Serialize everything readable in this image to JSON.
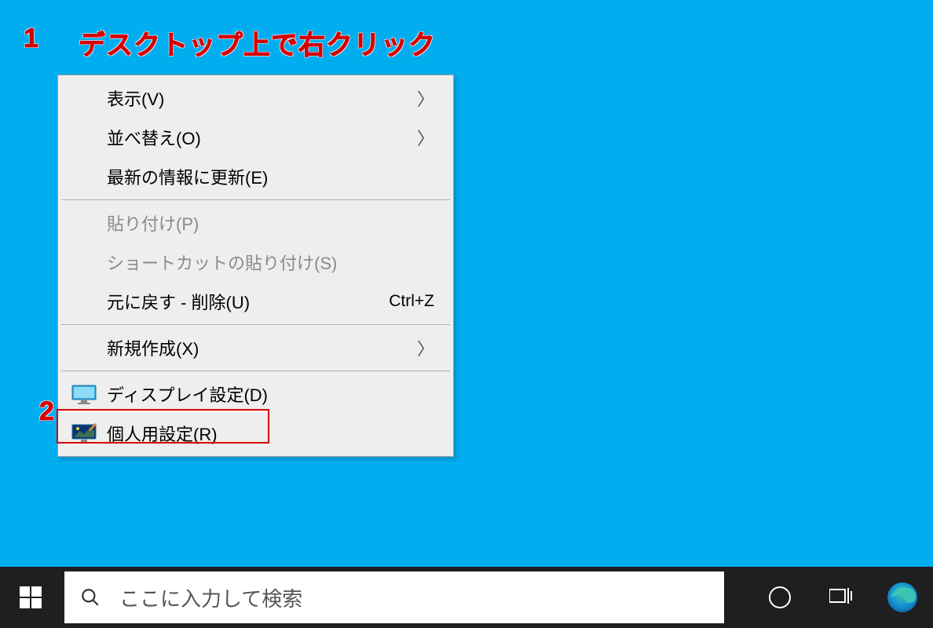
{
  "annotations": {
    "one": "1",
    "one_text": "デスクトップ上で右クリック",
    "two": "2"
  },
  "context_menu": {
    "items": [
      {
        "label": "表示(V)",
        "has_submenu": true
      },
      {
        "label": "並べ替え(O)",
        "has_submenu": true
      },
      {
        "label": "最新の情報に更新(E)"
      }
    ],
    "items2": [
      {
        "label": "貼り付け(P)",
        "disabled": true
      },
      {
        "label": "ショートカットの貼り付け(S)",
        "disabled": true
      },
      {
        "label": "元に戻す - 削除(U)",
        "shortcut": "Ctrl+Z"
      }
    ],
    "items3": [
      {
        "label": "新規作成(X)",
        "has_submenu": true
      }
    ],
    "items4": [
      {
        "label": "ディスプレイ設定(D)",
        "icon": "display"
      },
      {
        "label": "個人用設定(R)",
        "icon": "personalize"
      }
    ]
  },
  "taskbar": {
    "search_placeholder": "ここに入力して検索"
  }
}
